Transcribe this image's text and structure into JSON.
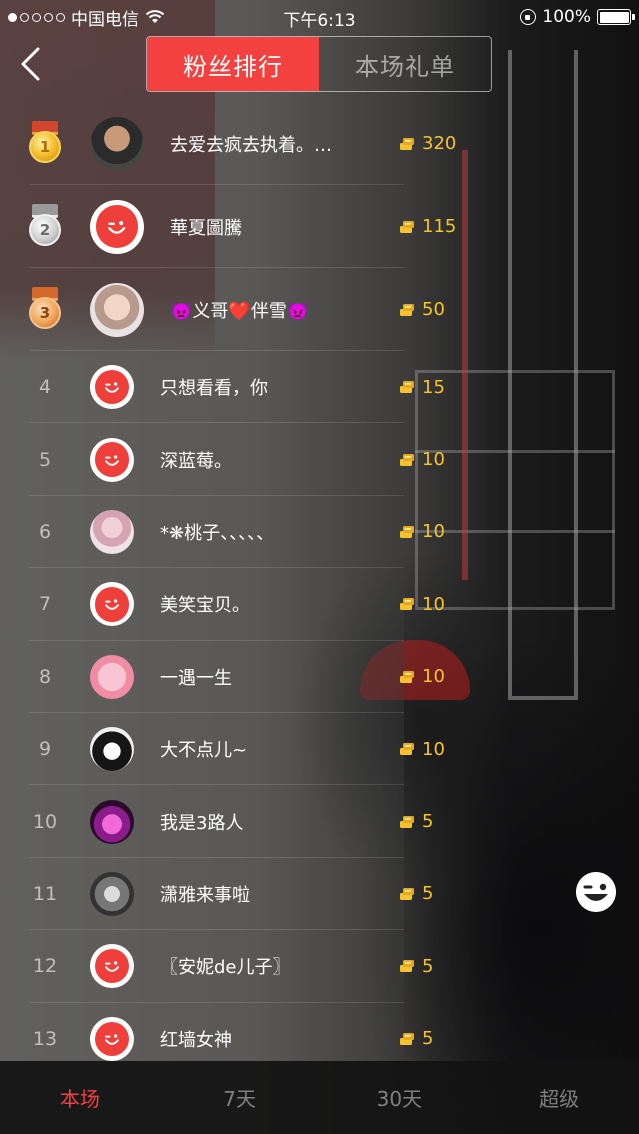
{
  "status_bar": {
    "carrier": "中国电信",
    "time": "下午6:13",
    "battery": "100%"
  },
  "header": {
    "tabs": [
      {
        "label": "粉丝排行",
        "active": true
      },
      {
        "label": "本场礼单",
        "active": false
      }
    ]
  },
  "ranking": [
    {
      "rank": "1",
      "name": "去爱去疯去执着。…",
      "coins": "320",
      "avatar": "photo-man"
    },
    {
      "rank": "2",
      "name": "華夏圖騰",
      "coins": "115",
      "avatar": "default"
    },
    {
      "rank": "3",
      "name": "👿义哥❤️伴雪👿",
      "coins": "50",
      "avatar": "photo-woman"
    },
    {
      "rank": "4",
      "name": "只想看看，你",
      "coins": "15",
      "avatar": "default"
    },
    {
      "rank": "5",
      "name": "深蓝莓。",
      "coins": "10",
      "avatar": "default"
    },
    {
      "rank": "6",
      "name": "*❋桃子、、、、、",
      "coins": "10",
      "avatar": "photo-pink"
    },
    {
      "rank": "7",
      "name": "美笑宝贝。",
      "coins": "10",
      "avatar": "default"
    },
    {
      "rank": "8",
      "name": "一遇一生",
      "coins": "10",
      "avatar": "photo-cartoon"
    },
    {
      "rank": "9",
      "name": "大不点儿~",
      "coins": "10",
      "avatar": "photo-bw"
    },
    {
      "rank": "10",
      "name": "我是3路人",
      "coins": "5",
      "avatar": "photo-lotus"
    },
    {
      "rank": "11",
      "name": "潇雅来事啦",
      "coins": "5",
      "avatar": "photo-gray"
    },
    {
      "rank": "12",
      "name": "〖安妮de儿子〗",
      "coins": "5",
      "avatar": "default"
    },
    {
      "rank": "13",
      "name": "红墙女神",
      "coins": "5",
      "avatar": "default"
    }
  ],
  "bottom_tabs": [
    {
      "label": "本场",
      "active": true
    },
    {
      "label": "7天",
      "active": false
    },
    {
      "label": "30天",
      "active": false
    },
    {
      "label": "超级",
      "active": false
    }
  ],
  "colors": {
    "accent": "#f2413f",
    "coin": "#f6c330"
  },
  "icons": {
    "back": "chevron-left-icon",
    "coin": "gold-coins-icon",
    "side_button": "wink-face-icon"
  }
}
